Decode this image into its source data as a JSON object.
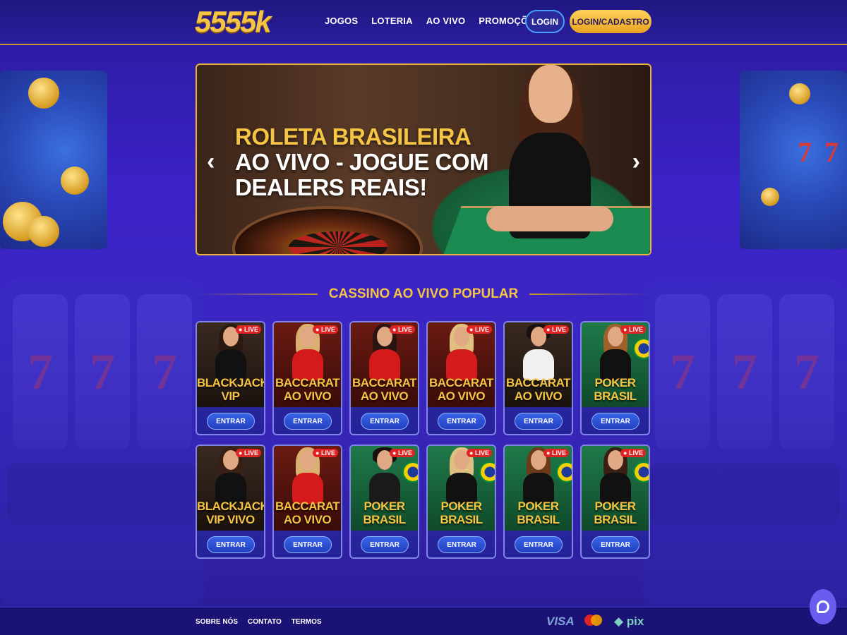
{
  "header": {
    "logo": "5555k",
    "nav": [
      "JOGOS",
      "LOTERIA",
      "AO VIVO",
      "PROMOÇÕES"
    ],
    "login_label": "LOGIN",
    "cadastro_label": "LOGIN/CADASTRO"
  },
  "hero": {
    "title_line1": "ROLETA BRASILEIRA",
    "title_line2": "AO VIVO - JOGUE COM",
    "title_line3": "DEALERS REAIS!",
    "prev_icon": "‹",
    "next_icon": "›"
  },
  "section": {
    "title": "CASSINO AO VIVO POPULAR"
  },
  "cards": [
    {
      "line1": "BLACKJACK",
      "line2": "VIP",
      "live": "● LIVE",
      "button": "ENTRAR"
    },
    {
      "line1": "BACCARAT",
      "line2": "AO VIVO",
      "live": "● LIVE",
      "button": "ENTRAR"
    },
    {
      "line1": "BACCARAT",
      "line2": "AO VIVO",
      "live": "● LIVE",
      "button": "ENTRAR"
    },
    {
      "line1": "BACCARAT",
      "line2": "AO VIVO",
      "live": "● LIVE",
      "button": "ENTRAR"
    },
    {
      "line1": "BACCARAT",
      "line2": "AO VIVO",
      "live": "● LIVE",
      "button": "ENTRAR"
    },
    {
      "line1": "POKER",
      "line2": "BRASIL",
      "live": "● LIVE",
      "button": "ENTRAR"
    },
    {
      "line1": "BLACKJACK",
      "line2": "VIP VIVO",
      "live": "● LIVE",
      "button": "ENTRAR"
    },
    {
      "line1": "BACCARAT",
      "line2": "AO VIVO",
      "live": "● LIVE",
      "button": "ENTRAR"
    },
    {
      "line1": "POKER",
      "line2": "BRASIL",
      "live": "● LIVE",
      "button": "ENTRAR"
    },
    {
      "line1": "POKER",
      "line2": "BRASIL",
      "live": "● LIVE",
      "button": "ENTRAR"
    },
    {
      "line1": "POKER",
      "line2": "BRASIL",
      "live": "● LIVE",
      "button": "ENTRAR"
    },
    {
      "line1": "POKER",
      "line2": "BRASIL",
      "live": "● LIVE",
      "button": "ENTRAR"
    }
  ],
  "footer": {
    "links": [
      "SOBRE NÓS",
      "CONTATO",
      "TERMOS"
    ],
    "visa": "VISA",
    "pix": "pix"
  },
  "colors": {
    "accent_gold": "#f5c445",
    "primary_blue": "#3a64e8",
    "live_red": "#e02424"
  }
}
